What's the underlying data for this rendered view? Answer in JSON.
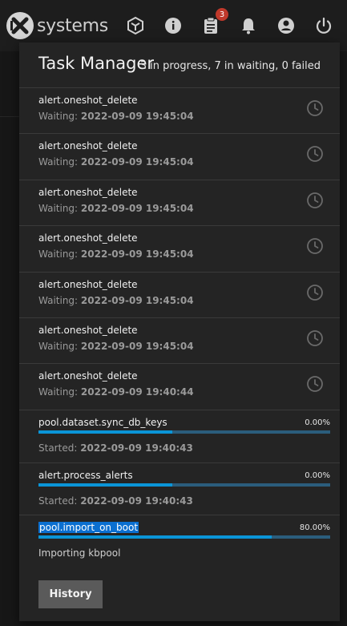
{
  "header": {
    "logo_text": "systems",
    "icons": [
      "truecommand-icon",
      "info-icon",
      "clipboard-icon",
      "bell-icon",
      "account-icon",
      "power-icon"
    ],
    "task_badge": "3"
  },
  "task_manager": {
    "title": "Task Manager",
    "summary": "3 in progress, 7 in waiting, 0 failed",
    "waiting_tasks": [
      {
        "name": "alert.oneshot_delete",
        "status_label": "Waiting:",
        "time": "2022-09-09 19:45:04"
      },
      {
        "name": "alert.oneshot_delete",
        "status_label": "Waiting:",
        "time": "2022-09-09 19:45:04"
      },
      {
        "name": "alert.oneshot_delete",
        "status_label": "Waiting:",
        "time": "2022-09-09 19:45:04"
      },
      {
        "name": "alert.oneshot_delete",
        "status_label": "Waiting:",
        "time": "2022-09-09 19:45:04"
      },
      {
        "name": "alert.oneshot_delete",
        "status_label": "Waiting:",
        "time": "2022-09-09 19:45:04"
      },
      {
        "name": "alert.oneshot_delete",
        "status_label": "Waiting:",
        "time": "2022-09-09 19:45:04"
      },
      {
        "name": "alert.oneshot_delete",
        "status_label": "Waiting:",
        "time": "2022-09-09 19:40:44"
      }
    ],
    "running_tasks": [
      {
        "name": "pool.dataset.sync_db_keys",
        "percent": "0.00%",
        "progress": 0.46,
        "status_label": "Started:",
        "time": "2022-09-09 19:40:43"
      },
      {
        "name": "alert.process_alerts",
        "percent": "0.00%",
        "progress": 0.46,
        "status_label": "Started:",
        "time": "2022-09-09 19:40:43"
      },
      {
        "name": "pool.import_on_boot",
        "percent": "80.00%",
        "progress": 0.8,
        "description": "Importing kbpool"
      }
    ],
    "history_label": "History"
  },
  "colors": {
    "accent": "#0a95d8",
    "badge": "#c0392b",
    "panel": "#242424"
  }
}
